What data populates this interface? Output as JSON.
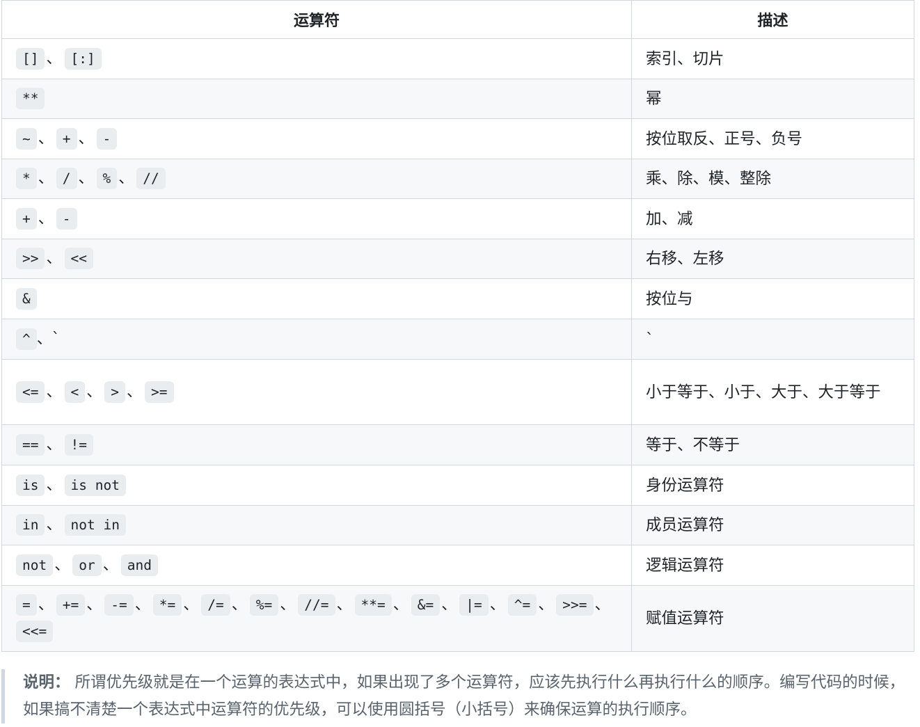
{
  "table": {
    "headers": [
      "运算符",
      "描述"
    ],
    "rows": [
      {
        "ops": [
          "[]",
          "[:]"
        ],
        "desc": "索引、切片",
        "h": 58
      },
      {
        "ops": [
          "**"
        ],
        "desc": "幂",
        "h": 57
      },
      {
        "ops": [
          "~",
          "+",
          "-"
        ],
        "desc": "按位取反、正号、负号",
        "h": 58
      },
      {
        "ops": [
          "*",
          "/",
          "%",
          "//"
        ],
        "desc": "乘、除、模、整除",
        "h": 57
      },
      {
        "ops": [
          "+",
          "-"
        ],
        "desc": "加、减",
        "h": 58
      },
      {
        "ops": [
          ">>",
          "<<"
        ],
        "desc": "右移、左移",
        "h": 57
      },
      {
        "ops": [
          "&"
        ],
        "desc": "按位与",
        "h": 58
      },
      {
        "ops": [
          "^"
        ],
        "ops_suffix": "、`",
        "desc": "`",
        "h": 58
      },
      {
        "ops": [
          "<=",
          "<",
          ">",
          ">="
        ],
        "desc": "小于等于、小于、大于、大于等于",
        "h": 94
      },
      {
        "ops": [
          "==",
          "!="
        ],
        "desc": "等于、不等于",
        "h": 58
      },
      {
        "ops": [
          "is",
          "is not"
        ],
        "desc": "身份运算符",
        "h": 58
      },
      {
        "ops": [
          "in",
          "not in"
        ],
        "desc": "成员运算符",
        "h": 57
      },
      {
        "ops": [
          "not",
          "or",
          "and"
        ],
        "desc": "逻辑运算符",
        "h": 58
      },
      {
        "ops": [
          "=",
          "+=",
          "-=",
          "*=",
          "/=",
          "%=",
          "//=",
          "**=",
          "&=",
          "|=",
          "^=",
          ">>=",
          "<<="
        ],
        "desc": "赋值运算符",
        "h": 95
      }
    ]
  },
  "note": {
    "label": "说明：",
    "text": "所谓优先级就是在一个运算的表达式中，如果出现了多个运算符，应该先执行什么再执行什么的顺序。编写代码的时候，如果搞不清楚一个表达式中运算符的优先级，可以使用圆括号（小括号）来确保运算的执行顺序。"
  }
}
